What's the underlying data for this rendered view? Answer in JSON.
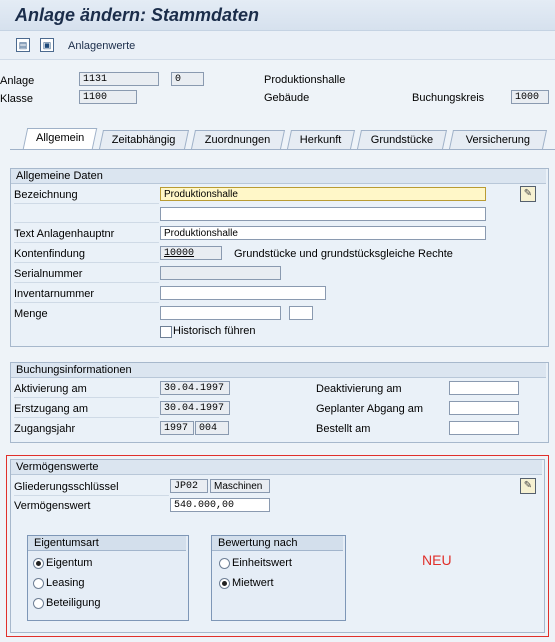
{
  "title": "Anlage ändern:  Stammdaten",
  "toolbar": {
    "label": "Anlagenwerte"
  },
  "header": {
    "anlage_label": "Anlage",
    "anlage_value": "1131",
    "anlage_sub": "0",
    "klasse_label": "Klasse",
    "klasse_value": "1100",
    "anlage_text": "Produktionshalle",
    "klasse_text": "Gebäude",
    "buchungskreis_label": "Buchungskreis",
    "buchungskreis_value": "1000"
  },
  "tabs": [
    {
      "label": "Allgemein"
    },
    {
      "label": "Zeitabhängig"
    },
    {
      "label": "Zuordnungen"
    },
    {
      "label": "Herkunft"
    },
    {
      "label": "Grundstücke"
    },
    {
      "label": "Versicherung"
    }
  ],
  "allgemeine_daten": {
    "title": "Allgemeine Daten",
    "bezeichnung_label": "Bezeichnung",
    "bezeichnung_value": "Produktionshalle",
    "textnr_label": "Text Anlagenhauptnr",
    "textnr_value": "Produktionshalle",
    "kontenfindung_label": "Kontenfindung",
    "kontenfindung_value": "10000",
    "kontenfindung_text": "Grundstücke und grundstücksgleiche Rechte",
    "serial_label": "Serialnummer",
    "inventar_label": "Inventarnummer",
    "menge_label": "Menge",
    "historisch_label": "Historisch führen"
  },
  "buchungsinfo": {
    "title": "Buchungsinformationen",
    "aktivierung_label": "Aktivierung am",
    "aktivierung_value": "30.04.1997",
    "erstzugang_label": "Erstzugang am",
    "erstzugang_value": "30.04.1997",
    "zugangsjahr_label": "Zugangsjahr",
    "zugangsjahr_value": "1997",
    "zugangsjahr_period": "004",
    "deaktivierung_label": "Deaktivierung am",
    "abgang_label": "Geplanter Abgang am",
    "bestellt_label": "Bestellt am"
  },
  "vermoegenswerte": {
    "title": "Vermögenswerte",
    "gliederung_label": "Gliederungsschlüssel",
    "gliederung_value": "JP02",
    "gliederung_text": "Maschinen",
    "wert_label": "Vermögenswert",
    "wert_value": "540.000,00",
    "eigentumsart": {
      "title": "Eigentumsart",
      "options": [
        "Eigentum",
        "Leasing",
        "Beteiligung"
      ],
      "selected": "Eigentum"
    },
    "bewertung": {
      "title": "Bewertung nach",
      "options": [
        "Einheitswert",
        "Mietwert"
      ],
      "selected": "Mietwert"
    },
    "neu_label": "NEU"
  },
  "colors": {
    "neu": "#e0302b",
    "frame": "#e0302b",
    "title": "#1b2d4a"
  }
}
